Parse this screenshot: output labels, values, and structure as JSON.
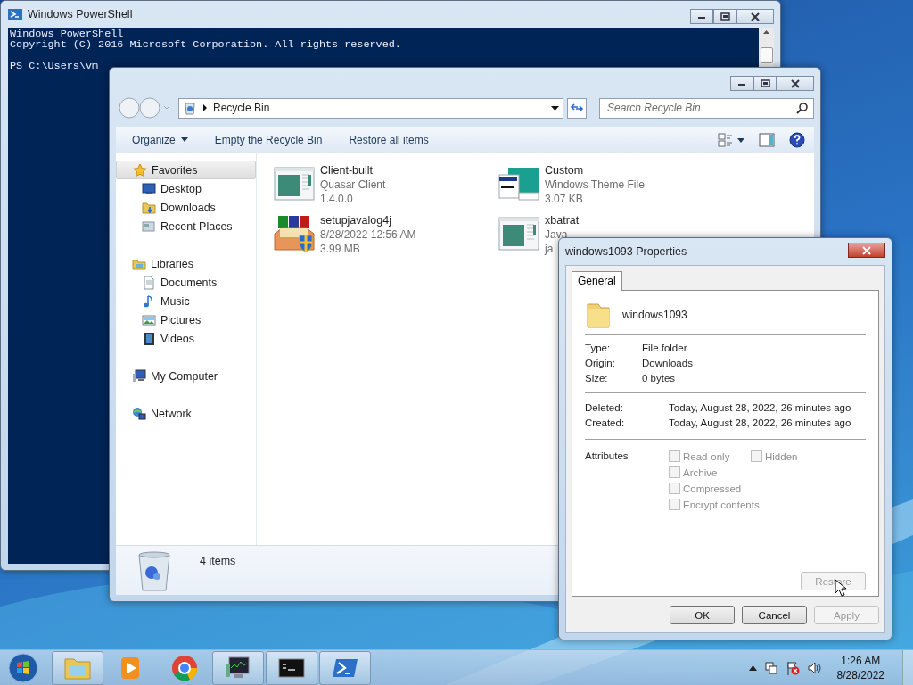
{
  "powershell": {
    "title": "Windows PowerShell",
    "banner": [
      "Windows PowerShell",
      "Copyright (C) 2016 Microsoft Corporation. All rights reserved."
    ],
    "prompt": "PS C:\\Users\\vm"
  },
  "explorer": {
    "crumbs": [
      "Recycle Bin"
    ],
    "search": {
      "placeholder": "Search Recycle Bin"
    },
    "commands": [
      {
        "label": "Organize",
        "dropdown": true
      },
      {
        "label": "Empty the Recycle Bin",
        "dropdown": false
      },
      {
        "label": "Restore all items",
        "dropdown": false
      }
    ],
    "nav": [
      {
        "label": "Favorites",
        "kind": "star",
        "selected": true,
        "children": [
          {
            "label": "Desktop",
            "kind": "desktop",
            "selected": false
          },
          {
            "label": "Downloads",
            "kind": "downloads",
            "selected": false
          },
          {
            "label": "Recent Places",
            "kind": "recent",
            "selected": false
          }
        ]
      },
      {
        "label": "Libraries",
        "kind": "libraries",
        "selected": false,
        "children": [
          {
            "label": "Documents",
            "kind": "documents",
            "selected": false
          },
          {
            "label": "Music",
            "kind": "music",
            "selected": false
          },
          {
            "label": "Pictures",
            "kind": "pictures",
            "selected": false
          },
          {
            "label": "Videos",
            "kind": "videos",
            "selected": false
          }
        ]
      },
      {
        "label": "My Computer",
        "kind": "computer",
        "selected": false
      },
      {
        "label": "Network",
        "kind": "network",
        "selected": false
      }
    ],
    "items": [
      {
        "name": "Client-built",
        "kind": "app",
        "details": [
          "Quasar Client",
          "1.4.0.0"
        ]
      },
      {
        "name": "Custom",
        "kind": "theme",
        "details": [
          "Windows Theme File",
          "3.07 KB"
        ]
      },
      {
        "name": "setupjavalog4j",
        "kind": "installer",
        "details": [
          "8/28/2022 12:56 AM",
          "3.99 MB"
        ]
      },
      {
        "name": "xbatrat",
        "kind": "app",
        "details": [
          "Java",
          "ja"
        ]
      }
    ],
    "status": "4 items"
  },
  "dialog": {
    "title": "windows1093 Properties",
    "tabs": [
      {
        "label": "General",
        "selected": true
      }
    ],
    "name": "windows1093",
    "info": [
      {
        "label": "Type:",
        "value": "File folder"
      },
      {
        "label": "Origin:",
        "value": "Downloads"
      },
      {
        "label": "Size:",
        "value": "0 bytes"
      }
    ],
    "dates": [
      {
        "label": "Deleted:",
        "value": "Today, August 28, 2022, 26 minutes ago"
      },
      {
        "label": "Created:",
        "value": "Today, August 28, 2022, 26 minutes ago"
      }
    ],
    "attributes_label": "Attributes",
    "attributes": [
      {
        "label": "Read-only",
        "checked": false,
        "disabled": true
      },
      {
        "label": "Hidden",
        "checked": false,
        "disabled": true
      },
      {
        "label": "Archive",
        "checked": false,
        "disabled": true
      },
      {
        "label": "Compressed",
        "checked": false,
        "disabled": true
      },
      {
        "label": "Encrypt contents",
        "checked": false,
        "disabled": true
      }
    ],
    "restore": {
      "label": "Restore",
      "disabled": true
    },
    "buttons": [
      {
        "label": "OK",
        "disabled": false
      },
      {
        "label": "Cancel",
        "disabled": false
      },
      {
        "label": "Apply",
        "disabled": true
      }
    ]
  },
  "taskbar": {
    "apps": [
      {
        "kind": "explorer",
        "open": true
      },
      {
        "kind": "media",
        "open": false
      },
      {
        "kind": "chrome",
        "open": false
      },
      {
        "kind": "monitor",
        "open": true
      },
      {
        "kind": "cmd",
        "open": true
      },
      {
        "kind": "powershell",
        "open": true
      }
    ],
    "clock": {
      "time": "1:26 AM",
      "date": "8/28/2022"
    }
  }
}
